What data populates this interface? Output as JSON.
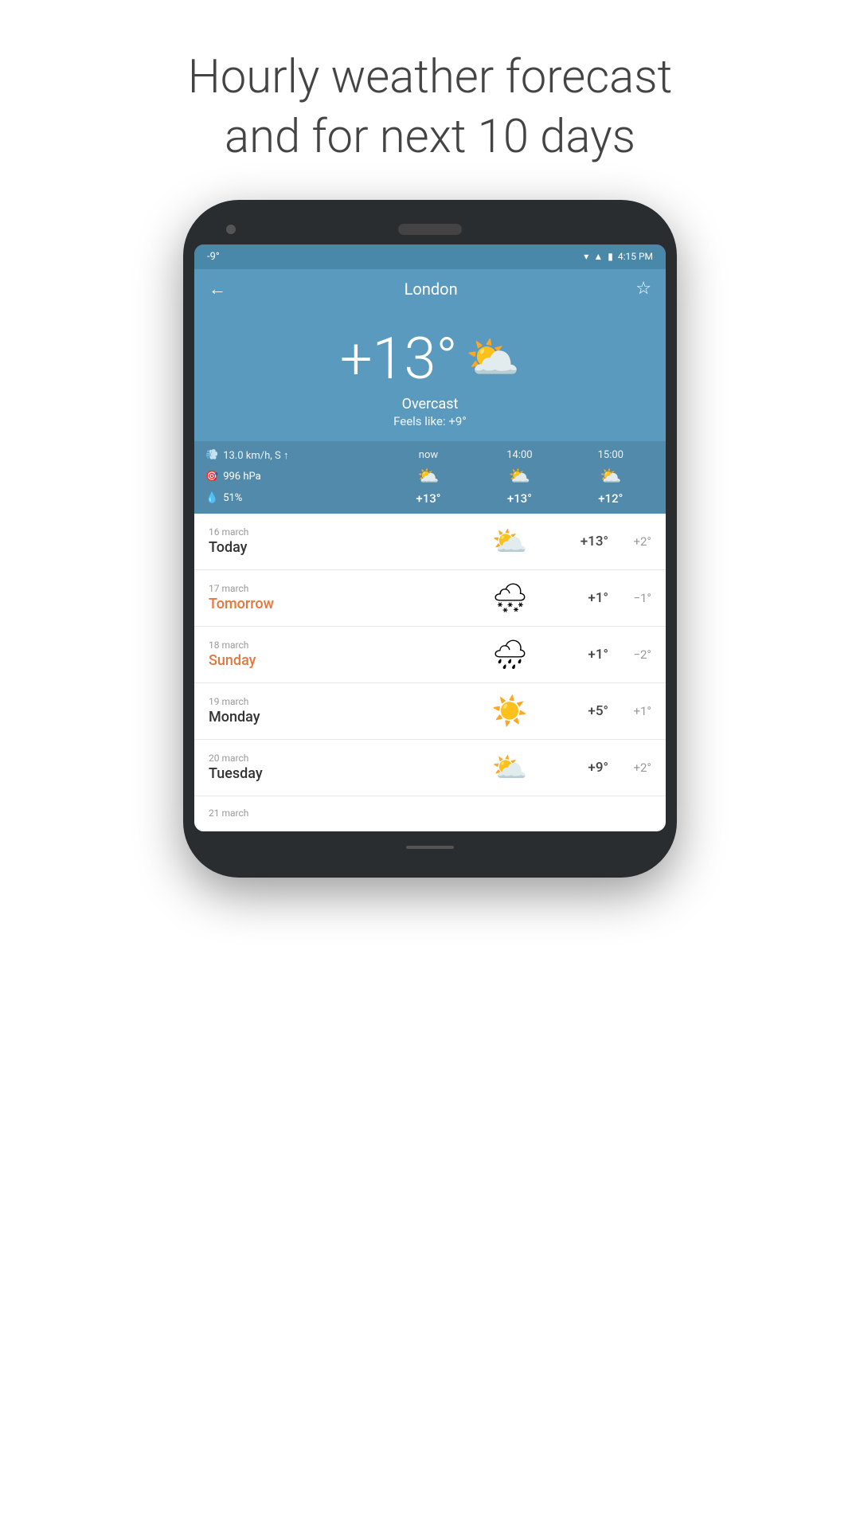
{
  "page": {
    "title_line1": "Hourly weather forecast",
    "title_line2": "and for next 10 days"
  },
  "status_bar": {
    "temperature": "-9°",
    "time": "4:15 PM"
  },
  "nav": {
    "back_icon": "←",
    "city": "London",
    "star_icon": "☆"
  },
  "current_weather": {
    "temp": "+13°",
    "icon": "⛅",
    "description": "Overcast",
    "feels_like": "Feels like: +9°"
  },
  "hourly": {
    "wind": "13.0 km/h, S ↑",
    "pressure": "996 hPa",
    "humidity": "51%",
    "times": [
      "now",
      "14:00",
      "15:00"
    ],
    "icons": [
      "⛅",
      "⛅",
      "⛅"
    ],
    "temps": [
      "+13°",
      "+13°",
      "+12°"
    ]
  },
  "forecast": [
    {
      "date": "16 march",
      "day": "Today",
      "highlight": false,
      "icon": "⛅",
      "high": "+13°",
      "low": "+2°"
    },
    {
      "date": "17 march",
      "day": "Tomorrow",
      "highlight": true,
      "icon": "🌨",
      "high": "+1°",
      "low": "−1°"
    },
    {
      "date": "18 march",
      "day": "Sunday",
      "highlight": true,
      "icon": "🌧",
      "high": "+1°",
      "low": "−2°"
    },
    {
      "date": "19 march",
      "day": "Monday",
      "highlight": false,
      "icon": "☀️",
      "high": "+5°",
      "low": "+1°"
    },
    {
      "date": "20 march",
      "day": "Tuesday",
      "highlight": false,
      "icon": "⛅",
      "high": "+9°",
      "low": "+2°"
    },
    {
      "date": "21 march",
      "day": "",
      "highlight": false,
      "icon": "",
      "high": "",
      "low": ""
    }
  ]
}
